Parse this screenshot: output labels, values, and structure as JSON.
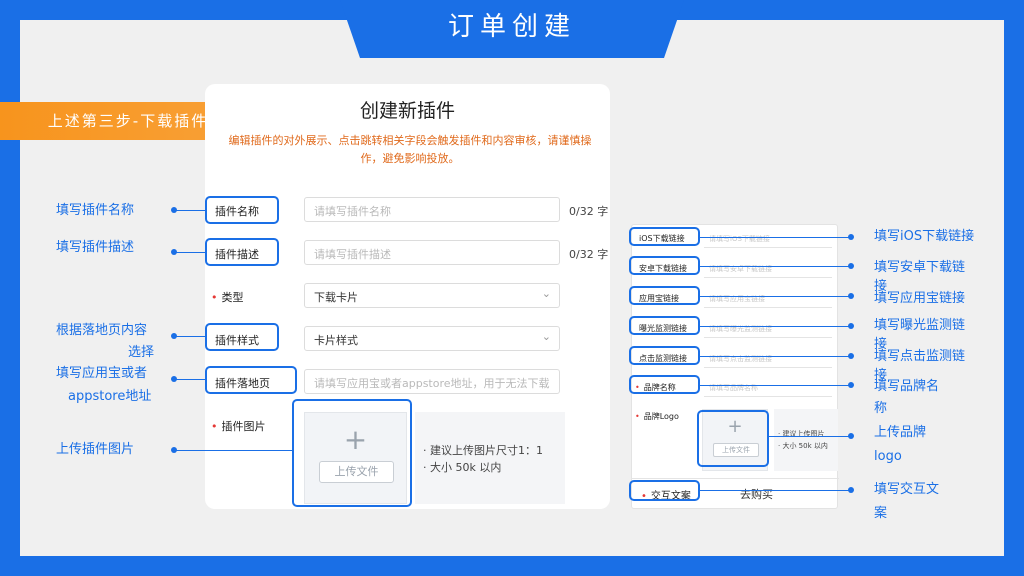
{
  "header": {
    "title": "订单创建"
  },
  "banner": {
    "text": "上述第三步-下载插件"
  },
  "form": {
    "title": "创建新插件",
    "description": "编辑插件的对外展示、点击跳转相关字段会触发插件和内容审核，请谨慎操作，避免影响投放。",
    "fields": {
      "name": {
        "label": "插件名称",
        "placeholder": "请填写插件名称",
        "count": "0/32 字"
      },
      "desc": {
        "label": "插件描述",
        "placeholder": "请填写插件描述",
        "count": "0/32 字"
      },
      "type": {
        "label": "类型",
        "value": "下载卡片"
      },
      "style": {
        "label": "插件样式",
        "value": "卡片样式"
      },
      "landing": {
        "label": "插件落地页",
        "placeholder": "请填写应用宝或者appstore地址，用于无法下载"
      },
      "image": {
        "label": "插件图片",
        "upload_label": "上传文件",
        "hint1": "· 建议上传图片尺寸1：1",
        "hint2": "· 大小 50k 以内"
      }
    }
  },
  "side_form": {
    "rows": [
      {
        "label": "iOS下载链接",
        "placeholder": "请填写iOS下载链接"
      },
      {
        "label": "安卓下载链接",
        "placeholder": "请填写安卓下载链接"
      },
      {
        "label": "应用宝链接",
        "placeholder": "请填写应用宝链接"
      },
      {
        "label": "曝光监测链接",
        "placeholder": "请填写曝光监测链接"
      },
      {
        "label": "点击监测链接",
        "placeholder": "请填写点击监测链接"
      },
      {
        "label": "品牌名称",
        "placeholder": "请填写品牌名称"
      }
    ],
    "logo": {
      "label": "品牌Logo",
      "upload_label": "上传文件",
      "hint1": "· 建议上传图片",
      "hint2": "· 大小 50k 以内"
    },
    "interaction": {
      "label": "交互文案",
      "value": "去购买"
    }
  },
  "annotations": {
    "left": [
      "填写插件名称",
      "填写插件描述",
      [
        "根据落地页内容",
        "选择"
      ],
      [
        "填写应用宝或者",
        "appstore地址"
      ],
      "上传插件图片"
    ],
    "right": [
      "填写iOS下载链接",
      [
        "填写安卓下载链",
        "接"
      ],
      "填写应用宝链接",
      [
        "填写曝光监测链",
        "接"
      ],
      [
        "填写点击监测链",
        "接"
      ],
      [
        "填写品牌名",
        "称"
      ],
      [
        "上传品牌",
        "logo"
      ],
      [
        "填写交互文",
        "案"
      ]
    ]
  },
  "colors": {
    "accent": "#1a6fe6",
    "banner": "#f7941d",
    "warning_text": "#e06a1c",
    "required": "#e53935"
  }
}
